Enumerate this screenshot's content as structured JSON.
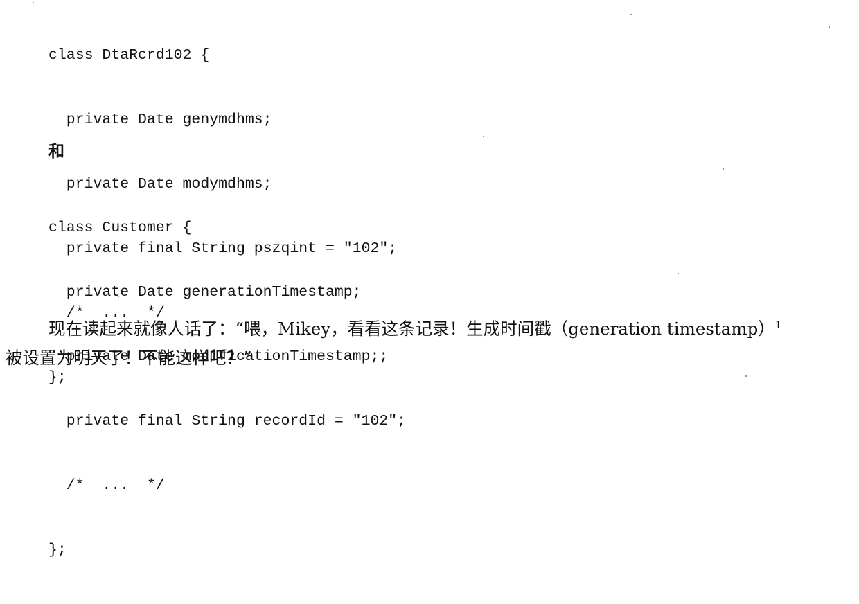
{
  "code_block_1": {
    "lines": [
      "class DtaRcrd102 {",
      "  private Date genymdhms;",
      "  private Date modymdhms;",
      "  private final String pszqint = \"102\";",
      "  /*  ...  */",
      "};"
    ]
  },
  "connector_text": "和",
  "code_block_2": {
    "lines": [
      "class Customer {",
      "  private Date generationTimestamp;",
      "  private Date modificationTimestamp;;",
      "  private final String recordId = \"102\";",
      "  /*  ...  */",
      "};"
    ]
  },
  "paragraph": {
    "line_1": "现在读起来就像人话了：“喂，Mikey，看看这条记录！生成时间戳（generation timestamp）",
    "footnote_mark": "1",
    "line_2": "被设置为明天了！不能这样吧？”"
  }
}
